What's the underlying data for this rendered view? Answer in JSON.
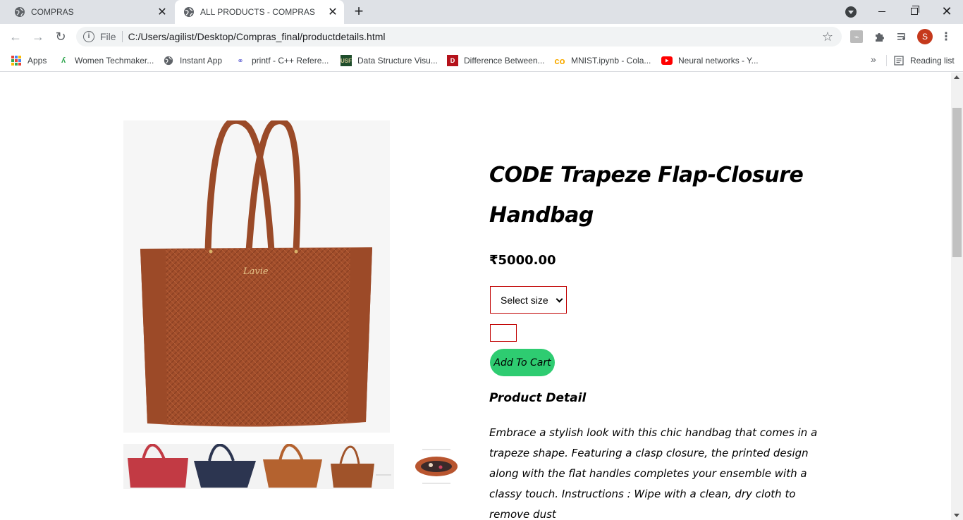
{
  "browser": {
    "tabs": [
      {
        "title": "COMPRAS",
        "active": false
      },
      {
        "title": "ALL PRODUCTS - COMPRAS",
        "active": true
      }
    ],
    "address": {
      "scheme": "File",
      "url": "C:/Users/agilist/Desktop/Compras_final/productdetails.html"
    },
    "profile_initial": "S",
    "bookmarks": [
      {
        "label": "Apps",
        "icon": "apps-grid-icon"
      },
      {
        "label": "Women Techmaker...",
        "icon": "women-techmakers-icon"
      },
      {
        "label": "Instant App",
        "icon": "globe-icon"
      },
      {
        "label": "printf - C++ Refere...",
        "icon": "cplusplus-icon"
      },
      {
        "label": "Data Structure Visu...",
        "icon": "usf-icon"
      },
      {
        "label": "Difference Between...",
        "icon": "td-icon"
      },
      {
        "label": "MNIST.ipynb - Cola...",
        "icon": "colab-icon"
      },
      {
        "label": "Neural networks - Y...",
        "icon": "youtube-icon"
      }
    ],
    "more_bookmarks": "»",
    "reading_list": "Reading list"
  },
  "product": {
    "title": "CODE Trapeze Flap-Closure Handbag",
    "price": "₹5000.00",
    "size_select": {
      "selected": "Select size"
    },
    "add_to_cart": "Add To Cart",
    "detail_heading": "Product Detail",
    "description": "Embrace a stylish look with this chic handbag that comes in a trapeze shape. Featuring a clasp closure, the printed design along with the flat handles completes your ensemble with a classy touch. Instructions : Wipe with a clean, dry cloth to remove dust",
    "main_image_brand": "Lavie",
    "thumbnails": [
      {
        "color": "#c23a44"
      },
      {
        "color": "#2c3550"
      },
      {
        "color": "#b4622f"
      },
      {
        "color": "#a0532a"
      },
      {
        "color": "#b8552f"
      }
    ]
  },
  "colors": {
    "cart_button": "#2ecc71",
    "input_border": "#c00000",
    "bag": "#a24e2b"
  }
}
